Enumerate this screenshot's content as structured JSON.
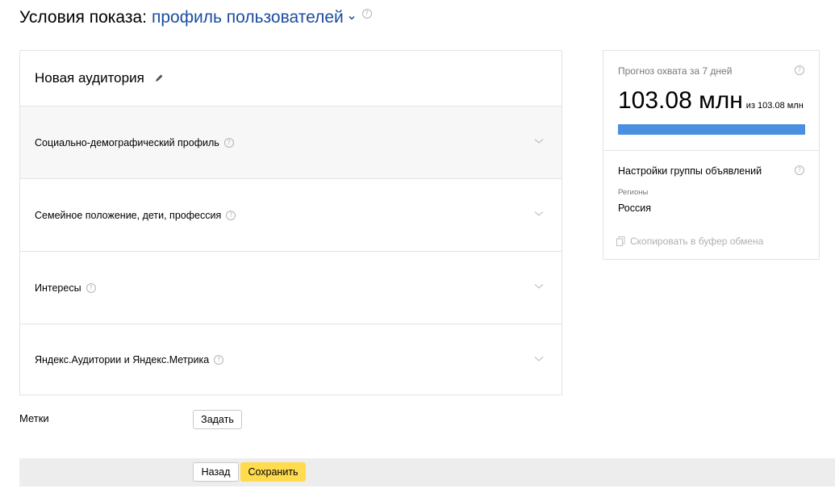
{
  "header": {
    "title_static": "Условия показа:",
    "title_dropdown": "профиль пользователей"
  },
  "audience": {
    "name": "Новая аудитория",
    "sections": [
      {
        "label": "Социально-демографический профиль"
      },
      {
        "label": "Семейное положение, дети, профессия"
      },
      {
        "label": "Интересы"
      },
      {
        "label": "Яндекс.Аудитории и Яндекс.Метрика"
      }
    ]
  },
  "tags": {
    "label": "Метки",
    "button": "Задать"
  },
  "footer": {
    "back": "Назад",
    "save": "Сохранить"
  },
  "forecast": {
    "title": "Прогноз охвата за 7 дней",
    "reach": "103.08 млн",
    "of_total": "из 103.08 млн",
    "progress_percent": 100,
    "bar_color": "#4a8fe0"
  },
  "group_settings": {
    "title": "Настройки группы объявлений",
    "regions_label": "Регионы",
    "regions_value": "Россия",
    "copy_link": "Скопировать в буфер обмена"
  },
  "colors": {
    "link": "#1b4da0",
    "save_button": "#ffdb4d",
    "footer_bar": "#ededed"
  }
}
